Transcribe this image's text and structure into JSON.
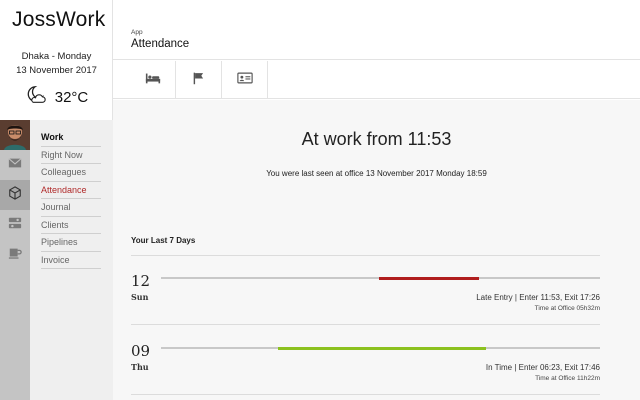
{
  "app": {
    "brand": "JossWork"
  },
  "location": {
    "line1": "Dhaka - Monday",
    "line2": "13 November 2017"
  },
  "weather": {
    "icon": "moon-cloud-icon",
    "temperature": "32°C"
  },
  "rail": {
    "items": [
      {
        "name": "avatar",
        "icon": "user-photo"
      },
      {
        "name": "mail",
        "icon": "envelope-icon"
      },
      {
        "name": "work",
        "icon": "cube-icon",
        "active": true
      },
      {
        "name": "toggles",
        "icon": "toggle-icon"
      },
      {
        "name": "coffee",
        "icon": "coffee-cup-icon"
      }
    ]
  },
  "menu": {
    "header": "Work",
    "items": [
      {
        "label": "Right Now"
      },
      {
        "label": "Colleagues"
      },
      {
        "label": "Attendance",
        "active": true
      },
      {
        "label": "Journal"
      },
      {
        "label": "Clients"
      },
      {
        "label": "Pipelines"
      },
      {
        "label": "Invoice"
      }
    ]
  },
  "header": {
    "breadcrumb": "App",
    "title": "Attendance"
  },
  "tabs": [
    {
      "icon": "bed-icon"
    },
    {
      "icon": "flag-icon"
    },
    {
      "icon": "id-card-icon"
    }
  ],
  "main": {
    "headline": "At work from 11:53",
    "last_seen": "You were last seen at office 13 November 2017 Monday 18:59",
    "section_title": "Your Last 7 Days"
  },
  "days": [
    {
      "num": "12",
      "dow": "Sun",
      "status": "Late Entry | Enter 11:53, Exit 17:26",
      "time_at_office": "Time at Office 05h32m",
      "bar": {
        "start": 0.497,
        "end": 0.725,
        "color": "#b01e1e"
      }
    },
    {
      "num": "09",
      "dow": "Thu",
      "status": "In Time | Enter 06:23, Exit 17:46",
      "time_at_office": "Time at Office 11h22m",
      "bar": {
        "start": 0.267,
        "end": 0.74,
        "color": "#8cc11f"
      }
    }
  ],
  "colors": {
    "accent": "#b02a2a",
    "late": "#b01e1e",
    "ontime": "#8cc11f"
  }
}
